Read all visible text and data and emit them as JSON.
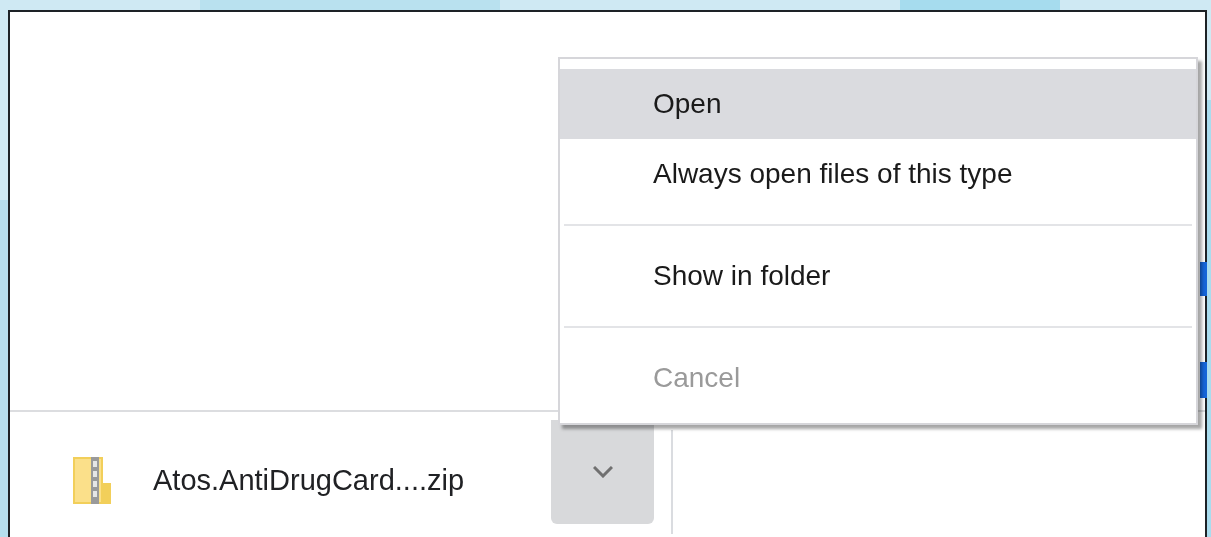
{
  "context_menu": {
    "groups": [
      [
        {
          "label": "Open",
          "selected": true,
          "disabled": false
        },
        {
          "label": "Always open files of this type",
          "selected": false,
          "disabled": false
        }
      ],
      [
        {
          "label": "Show in folder",
          "selected": false,
          "disabled": false
        }
      ],
      [
        {
          "label": "Cancel",
          "selected": false,
          "disabled": true
        }
      ]
    ]
  },
  "download_bar": {
    "items": [
      {
        "filename": "Atos.AntiDrugCard....zip"
      }
    ]
  }
}
